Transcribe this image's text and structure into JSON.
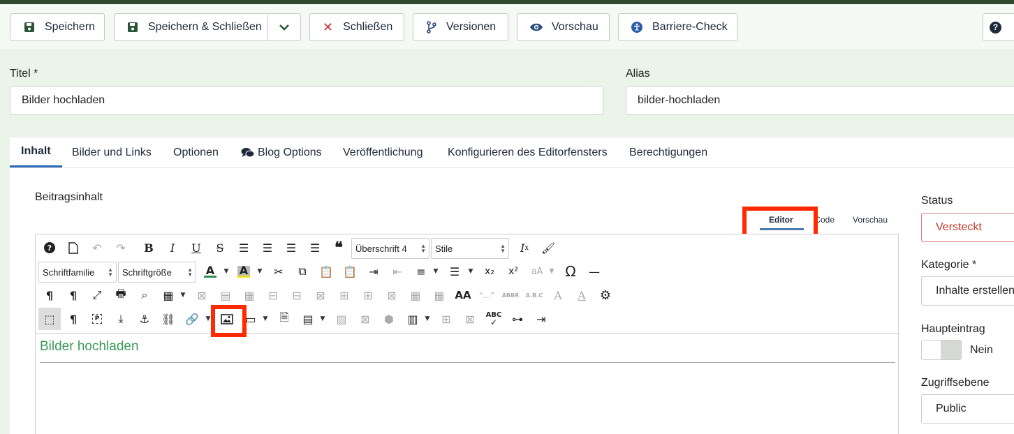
{
  "toolbar": {
    "save": "Speichern",
    "save_close": "Speichern & Schließen",
    "close": "Schließen",
    "versions": "Versionen",
    "preview": "Vorschau",
    "accessibility": "Barriere-Check"
  },
  "form": {
    "title_label": "Titel *",
    "title_value": "Bilder hochladen",
    "alias_label": "Alias",
    "alias_value": "bilder-hochladen"
  },
  "tabs": [
    "Inhalt",
    "Bilder und Links",
    "Optionen",
    "Blog Options",
    "Veröffentlichung",
    "Konfigurieren des Editorfensters",
    "Berechtigungen"
  ],
  "content": {
    "label": "Beitragsinhalt",
    "editor_tabs": {
      "editor": "Editor",
      "code": "Code",
      "preview": "Vorschau"
    },
    "heading_select": "Überschrift 4",
    "style_select": "Stile",
    "font_family_select": "Schriftfamilie",
    "font_size_select": "Schriftgröße",
    "body_heading": "Bilder hochladen"
  },
  "sidebar": {
    "status_label": "Status",
    "status_value": "Versteckt",
    "category_label": "Kategorie *",
    "category_value": "Inhalte erstellen",
    "featured_label": "Haupteintrag",
    "featured_value": "Nein",
    "access_label": "Zugriffsebene",
    "access_value": "Public"
  },
  "colors": {
    "accent": "#2a69b8",
    "status_text": "#c0392b",
    "heading_green": "#3a9a5a",
    "highlight": "#ff2a00"
  }
}
